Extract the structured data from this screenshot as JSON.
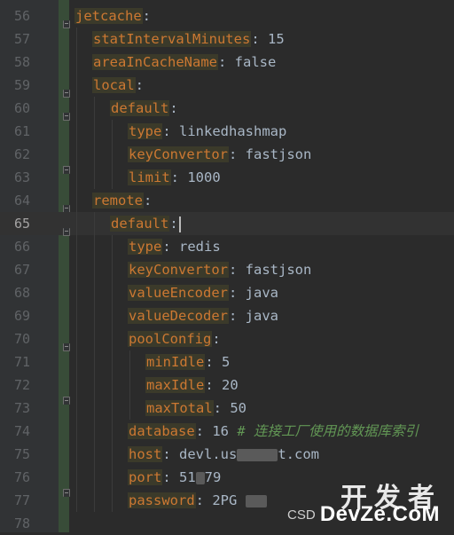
{
  "lines": [
    {
      "num": "56",
      "indent": 0,
      "key": "jetcache",
      "sep": ":",
      "val": "",
      "comment": "",
      "fold": "open"
    },
    {
      "num": "57",
      "indent": 1,
      "key": "statIntervalMinutes",
      "sep": ":",
      "val": " 15",
      "comment": "",
      "fold": ""
    },
    {
      "num": "58",
      "indent": 1,
      "key": "areaInCacheName",
      "sep": ":",
      "val": " false",
      "comment": "",
      "fold": ""
    },
    {
      "num": "59",
      "indent": 1,
      "key": "local",
      "sep": ":",
      "val": "",
      "comment": "",
      "fold": "open"
    },
    {
      "num": "60",
      "indent": 2,
      "key": "default",
      "sep": ":",
      "val": "",
      "comment": "",
      "fold": "open"
    },
    {
      "num": "61",
      "indent": 3,
      "key": "type",
      "sep": ":",
      "val": " linkedhashmap",
      "comment": "",
      "fold": ""
    },
    {
      "num": "62",
      "indent": 3,
      "key": "keyConvertor",
      "sep": ":",
      "val": " fastjson",
      "comment": "",
      "fold": ""
    },
    {
      "num": "63",
      "indent": 3,
      "key": "limit",
      "sep": ":",
      "val": " 1000",
      "comment": "",
      "fold": "close"
    },
    {
      "num": "64",
      "indent": 1,
      "key": "remote",
      "sep": ":",
      "val": "",
      "comment": "",
      "fold": "open"
    },
    {
      "num": "65",
      "indent": 2,
      "key": "default",
      "sep": ":",
      "val": "",
      "comment": "",
      "fold": "open",
      "current": true
    },
    {
      "num": "66",
      "indent": 3,
      "key": "type",
      "sep": ":",
      "val": " redis",
      "comment": "",
      "fold": ""
    },
    {
      "num": "67",
      "indent": 3,
      "key": "keyConvertor",
      "sep": ":",
      "val": " fastjson",
      "comment": "",
      "fold": ""
    },
    {
      "num": "68",
      "indent": 3,
      "key": "valueEncoder",
      "sep": ":",
      "val": " java",
      "comment": "",
      "fold": ""
    },
    {
      "num": "69",
      "indent": 3,
      "key": "valueDecoder",
      "sep": ":",
      "val": " java",
      "comment": "",
      "fold": ""
    },
    {
      "num": "70",
      "indent": 3,
      "key": "poolConfig",
      "sep": ":",
      "val": "",
      "comment": "",
      "fold": "open"
    },
    {
      "num": "71",
      "indent": 4,
      "key": "minIdle",
      "sep": ":",
      "val": " 5",
      "comment": "",
      "fold": ""
    },
    {
      "num": "72",
      "indent": 4,
      "key": "maxIdle",
      "sep": ":",
      "val": " 20",
      "comment": "",
      "fold": ""
    },
    {
      "num": "73",
      "indent": 4,
      "key": "maxTotal",
      "sep": ":",
      "val": " 50",
      "comment": "",
      "fold": "close"
    },
    {
      "num": "74",
      "indent": 3,
      "key": "database",
      "sep": ":",
      "val": " 16 ",
      "comment": "# 连接工厂使用的数据库索引",
      "fold": ""
    },
    {
      "num": "75",
      "indent": 3,
      "key": "host",
      "sep": ":",
      "val": " devl.us",
      "blur": 46,
      "val2": "t.com",
      "comment": "",
      "fold": ""
    },
    {
      "num": "76",
      "indent": 3,
      "key": "port",
      "sep": ":",
      "val": " 51",
      "blur": 10,
      "val2": "79",
      "comment": "",
      "fold": ""
    },
    {
      "num": "77",
      "indent": 3,
      "key": "password",
      "sep": ":",
      "val": " 2PG ",
      "blur": 24,
      "val2": "",
      "comment": "",
      "fold": "close"
    },
    {
      "num": "78",
      "indent": 0,
      "key": "",
      "sep": "",
      "val": "",
      "comment": "",
      "fold": ""
    }
  ],
  "watermark": {
    "cn": "开发者",
    "en": "DevZe.CoM",
    "csd": "CSD"
  },
  "colors": {
    "background": "#2b2b2b",
    "gutter": "#313335",
    "key": "#cc7832",
    "value": "#a9b7c6",
    "comment": "#629755",
    "line_number": "#606366"
  }
}
